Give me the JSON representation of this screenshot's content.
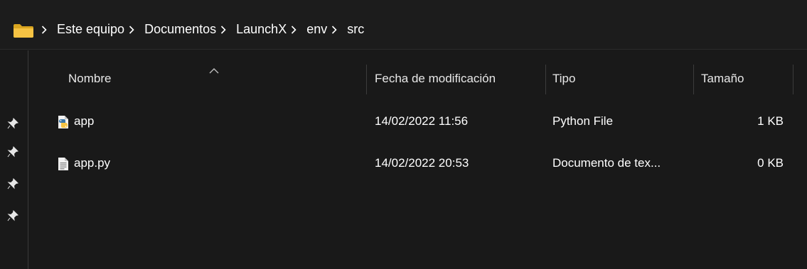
{
  "breadcrumb": [
    "Este equipo",
    "Documentos",
    "LaunchX",
    "env",
    "src"
  ],
  "columns": {
    "name": "Nombre",
    "modified": "Fecha de modificación",
    "type": "Tipo",
    "size": "Tamaño"
  },
  "files": [
    {
      "name": "app",
      "modified": "14/02/2022 11:56",
      "type": "Python File",
      "size": "1 KB",
      "icon": "python-file-icon"
    },
    {
      "name": "app.py",
      "modified": "14/02/2022 20:53",
      "type": "Documento de tex...",
      "size": "0 KB",
      "icon": "text-document-icon"
    }
  ],
  "colors": {
    "background": "#191919",
    "folder": "#f6c343",
    "text": "#ffffff",
    "divider": "#3c3c3c"
  }
}
